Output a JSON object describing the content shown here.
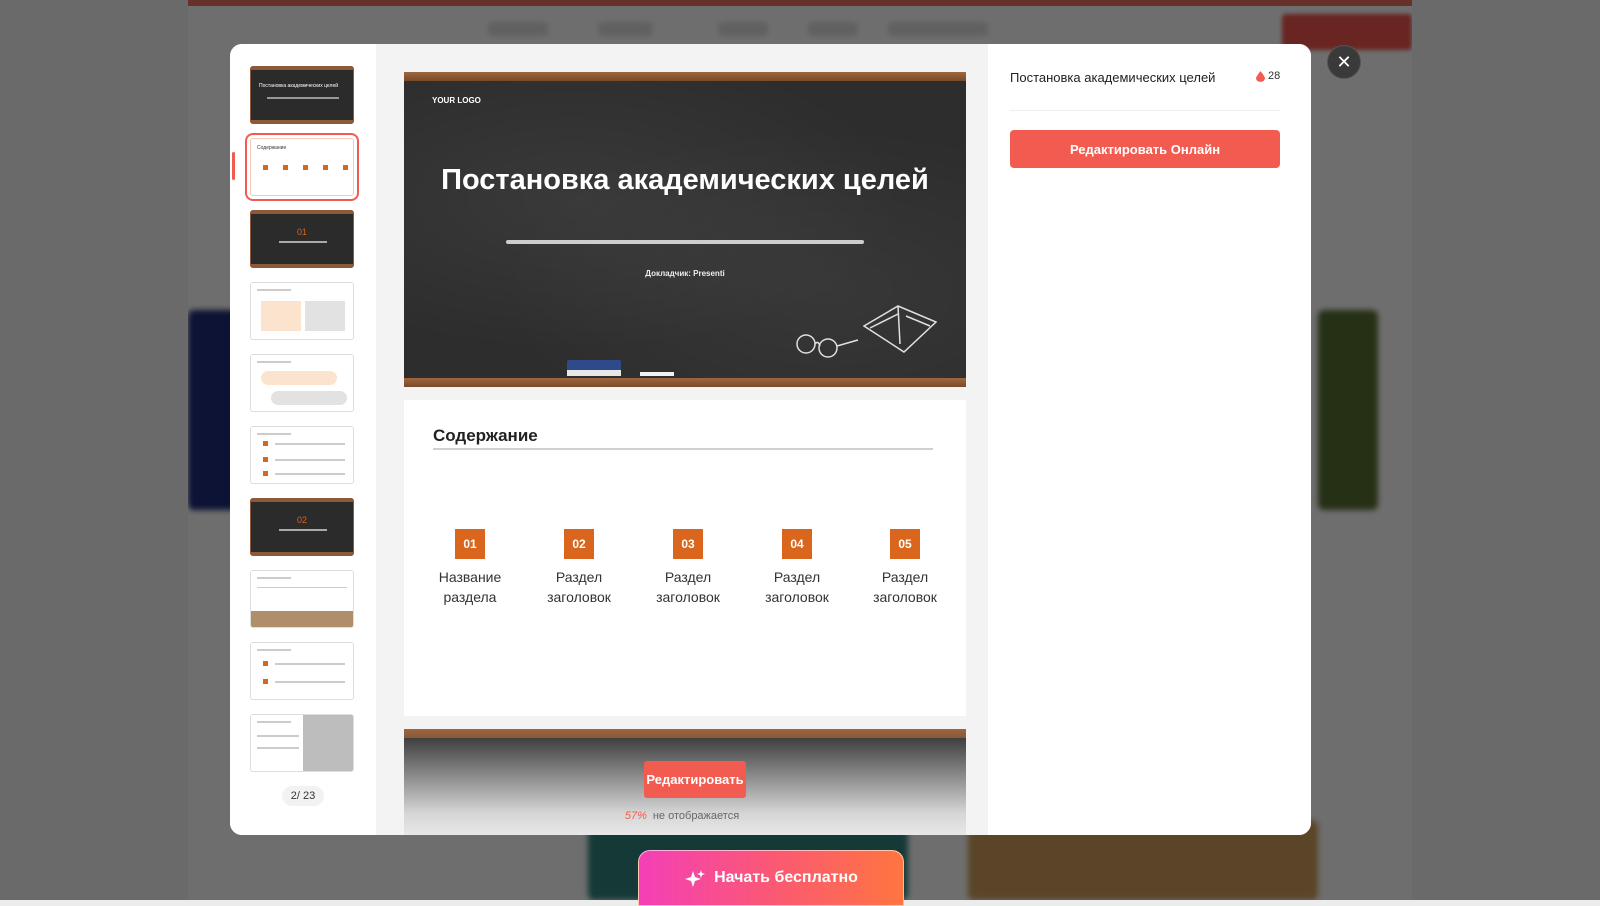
{
  "presentation": {
    "title": "Постановка академических целей",
    "likes": "28",
    "edit_online_label": "Редактировать Онлайн"
  },
  "slides": {
    "current": "2",
    "total": "23",
    "counter_sep": "/ ",
    "slide1": {
      "logo": "YOUR LOGO",
      "title": "Постановка академических целей",
      "speaker": "Докладчик:  Presenti"
    },
    "slide2": {
      "title": "Содержание",
      "items": [
        {
          "num": "01",
          "label": "Название раздела"
        },
        {
          "num": "02",
          "label": "Раздел заголовок"
        },
        {
          "num": "03",
          "label": "Раздел заголовок"
        },
        {
          "num": "04",
          "label": "Раздел заголовок"
        },
        {
          "num": "05",
          "label": "Раздел заголовок"
        }
      ]
    }
  },
  "preview_footer": {
    "edit_label": "Редактировать",
    "percent": "57%",
    "not_shown": "не отображается"
  },
  "cta": {
    "start_free": "Начать бесплатно"
  },
  "colors": {
    "accent": "#f25b50",
    "orange": "#d9661c",
    "chalkboard": "#2d2d2d"
  },
  "icons": {
    "close": "close-icon",
    "likes": "drop-icon",
    "sparkle": "sparkle-icon"
  }
}
